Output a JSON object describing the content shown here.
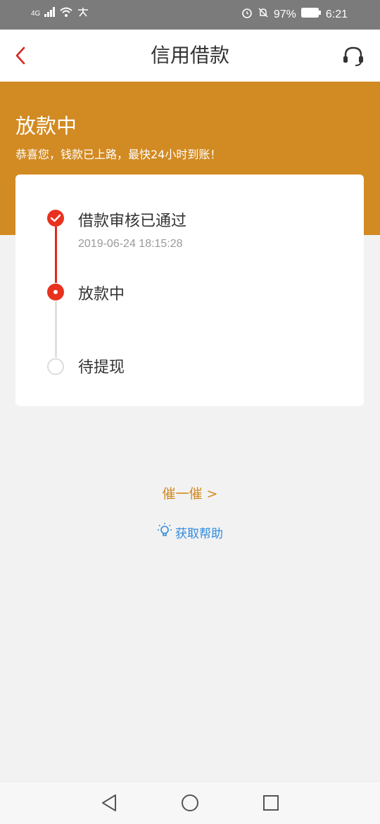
{
  "status_bar": {
    "network": "4G",
    "battery": "97%",
    "time": "6:21"
  },
  "nav": {
    "title": "信用借款"
  },
  "banner": {
    "title": "放款中",
    "subtitle": "恭喜您，钱款已上路，最快24小时到账！",
    "color": "#d28a22"
  },
  "timeline": {
    "steps": [
      {
        "label": "借款审核已通过",
        "time": "2019-06-24 18:15:28",
        "state": "done"
      },
      {
        "label": "放款中",
        "state": "active"
      },
      {
        "label": "待提现",
        "state": "pending"
      }
    ]
  },
  "actions": {
    "urge_label": "催一催 >",
    "help_label": "获取帮助"
  },
  "colors": {
    "accent_red": "#e8321f",
    "link_blue": "#2f8bde"
  }
}
